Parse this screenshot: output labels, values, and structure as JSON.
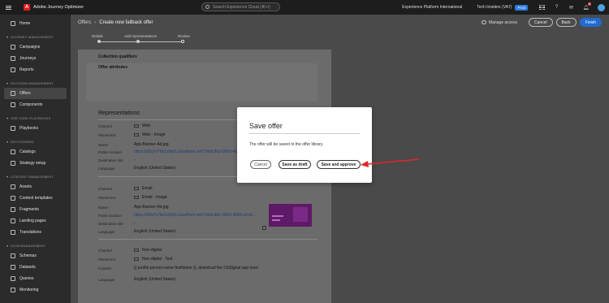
{
  "topbar": {
    "app_name": "Adobe Journey Optimizer",
    "logo_letter": "A",
    "search_placeholder": "Search Experience Cloud (⌘+/)",
    "org_name": "Experience Platform International",
    "sandbox": "Tech Insiders (VA7)",
    "env_badge": "Prod",
    "notification_count": "2"
  },
  "sidebar": {
    "items": [
      {
        "label": "Home"
      }
    ],
    "sections": [
      {
        "title": "JOURNEY MANAGEMENT",
        "items": [
          "Campaigns",
          "Journeys",
          "Reports"
        ]
      },
      {
        "title": "DECISION MANAGEMENT",
        "items": [
          "Offers",
          "Components"
        ]
      },
      {
        "title": "USE CASE PLAYBOOKS",
        "items": [
          "Playbooks"
        ]
      },
      {
        "title": "DECISIONING",
        "items": [
          "Catalogs",
          "Strategy setup"
        ]
      },
      {
        "title": "CONTENT MANAGEMENT",
        "items": [
          "Assets",
          "Content templates",
          "Fragments",
          "Landing pages",
          "Translations"
        ]
      },
      {
        "title": "DATA MANAGEMENT",
        "items": [
          "Schemas",
          "Datasets",
          "Queries",
          "Monitoring"
        ]
      }
    ],
    "active": "Offers"
  },
  "header": {
    "breadcrumb_parent": "Offers",
    "breadcrumb_current": "Create new fallback offer",
    "manage_access": "Manage access",
    "cancel": "Cancel",
    "back": "Back",
    "finish": "Finish"
  },
  "steps": [
    "Details",
    "Add representations",
    "Review"
  ],
  "collection": {
    "qualifiers_title": "Collection qualifiers",
    "attributes_title": "Offer attributes",
    "attributes_value": "-"
  },
  "representations": {
    "title": "Representations",
    "labels": {
      "channel": "Channel",
      "placement": "Placement",
      "name": "Name",
      "public_location": "Public location",
      "destination_link": "Destination link",
      "language": "Language",
      "content": "Content"
    },
    "web": {
      "channel": "Web",
      "placement": "Web - Image",
      "name": "App-Banner-Ad.jpg",
      "public_location": "https://d2q7o7kb1chfp5.cloudfront.net/79e9c8b2-0609-45",
      "destination_link": "-",
      "language": "English (United States)"
    },
    "email": {
      "channel": "Email",
      "placement": "Email - Image",
      "name": "App-Banner-Ad.jpg",
      "public_location": "https://d2q7o7kb1chfp5.cloudfront.net/79e9c8b2-0609-45b9-a3c8-...",
      "destination_link": "-",
      "language": "English (United States)"
    },
    "nondigital": {
      "channel": "Non-digital",
      "placement": "Non-digital - Text",
      "content": "{{ profile.person.name.firstName }}, download the CitiSignal app now!",
      "language": "English (United States)"
    }
  },
  "modal": {
    "title": "Save offer",
    "message": "The offer will be saved to the offer library.",
    "cancel": "Cancel",
    "save_draft": "Save as draft",
    "save_approve": "Save and approve"
  },
  "colors": {
    "accent": "#1f6bd2",
    "annotation_arrow": "#e0262b",
    "brand_red": "#e41b1b"
  }
}
